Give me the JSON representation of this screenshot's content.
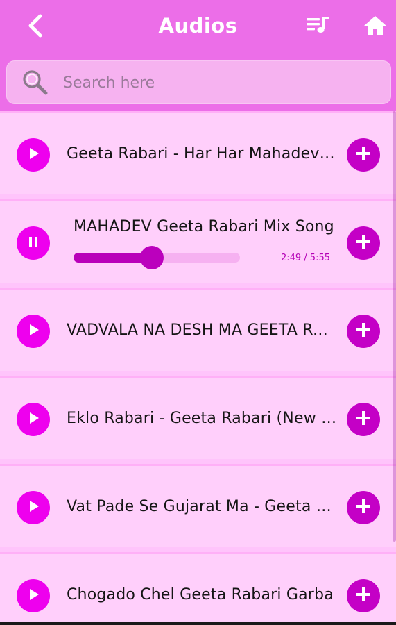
{
  "header": {
    "title": "Audios",
    "back_icon": "chevron-left-icon",
    "playlist_icon": "playlist-music-icon",
    "home_icon": "home-icon"
  },
  "search": {
    "placeholder": "Search here",
    "value": "",
    "icon": "search-icon"
  },
  "colors": {
    "header_bg": "#ec6ee8",
    "list_bg": "#ffcffb",
    "play_button": "#ee00ee",
    "add_button": "#c400c6",
    "progress_fill": "#b900b9",
    "progress_track": "#f6b1f1"
  },
  "songs": [
    {
      "title": "Geeta Rabari - Har Har Mahadev Mahadev Harhar",
      "state": "play"
    },
    {
      "title": "MAHADEV Geeta Rabari Mix Song",
      "state": "pause",
      "elapsed": "2:49",
      "duration": "5:55",
      "progress": 0.47,
      "time_text": "2:49 / 5:55"
    },
    {
      "title": "VADVALA NA DESH MA GEETA RABARI",
      "state": "play"
    },
    {
      "title": "Eklo Rabari - Geeta Rabari (New Song)",
      "state": "play"
    },
    {
      "title": "Vat Pade Se Gujarat Ma - Geeta Rabari",
      "state": "play"
    },
    {
      "title": "Chogado Chel Geeta Rabari Garba",
      "state": "play"
    }
  ]
}
